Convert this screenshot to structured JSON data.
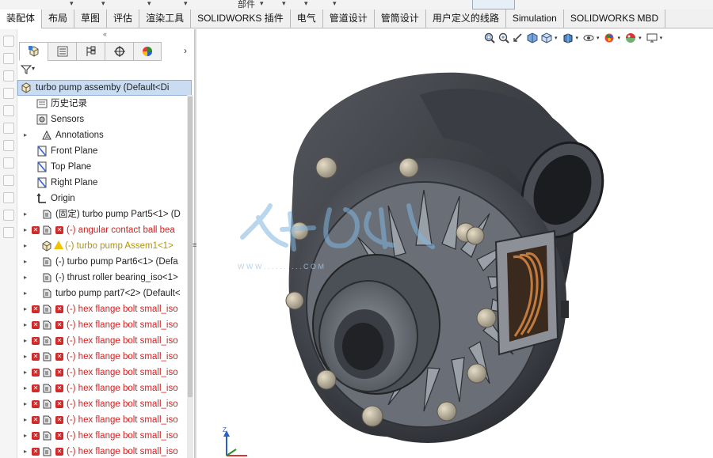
{
  "ribbon": {
    "partial_label": "部件"
  },
  "tabs": [
    {
      "label": "装配体",
      "active": true
    },
    {
      "label": "布局",
      "active": false
    },
    {
      "label": "草图",
      "active": false
    },
    {
      "label": "评估",
      "active": false
    },
    {
      "label": "渲染工具",
      "active": false
    },
    {
      "label": "SOLIDWORKS 插件",
      "active": false
    },
    {
      "label": "电气",
      "active": false
    },
    {
      "label": "管道设计",
      "active": false
    },
    {
      "label": "管筒设计",
      "active": false
    },
    {
      "label": "用户定义的线路",
      "active": false
    },
    {
      "label": "Simulation",
      "active": false
    },
    {
      "label": "SOLIDWORKS MBD",
      "active": false
    }
  ],
  "panel": {
    "collapse_glyph": "«",
    "tabs_more_glyph": "›",
    "tab_icons": [
      "feature-manager-icon",
      "property-manager-icon",
      "configuration-manager-icon",
      "dimxpert-manager-icon",
      "display-manager-icon"
    ],
    "filter_icon": "filter-icon"
  },
  "tree": {
    "root": {
      "label": "turbo pump assemby  (Default<Di",
      "icon": "assembly-icon"
    },
    "items": [
      {
        "label": "历史记录",
        "icon": "history-icon",
        "expander": false,
        "style": "normal",
        "status": ""
      },
      {
        "label": "Sensors",
        "icon": "sensors-icon",
        "expander": false,
        "style": "normal",
        "status": ""
      },
      {
        "label": "Annotations",
        "icon": "annotations-icon",
        "expander": true,
        "style": "normal",
        "status": ""
      },
      {
        "label": "Front Plane",
        "icon": "plane-icon",
        "expander": false,
        "style": "normal",
        "status": ""
      },
      {
        "label": "Top Plane",
        "icon": "plane-icon",
        "expander": false,
        "style": "normal",
        "status": ""
      },
      {
        "label": "Right Plane",
        "icon": "plane-icon",
        "expander": false,
        "style": "normal",
        "status": ""
      },
      {
        "label": "Origin",
        "icon": "origin-icon",
        "expander": false,
        "style": "normal",
        "status": ""
      },
      {
        "label": "(固定) turbo pump Part5<1> (D",
        "icon": "part-icon",
        "expander": true,
        "style": "normal",
        "status": ""
      },
      {
        "label": "(-) angular contact ball bea",
        "icon": "part-icon",
        "expander": true,
        "style": "red",
        "status": "error"
      },
      {
        "label": "(-) turbo pump Assem1<1>",
        "icon": "subassembly-icon",
        "expander": true,
        "style": "gold",
        "status": "warning"
      },
      {
        "label": "(-) turbo pump Part6<1> (Defa",
        "icon": "part-icon",
        "expander": true,
        "style": "normal",
        "status": ""
      },
      {
        "label": "(-) thrust roller bearing_iso<1>",
        "icon": "part-icon",
        "expander": true,
        "style": "normal",
        "status": ""
      },
      {
        "label": "turbo pump part7<2> (Default<",
        "icon": "part-icon",
        "expander": true,
        "style": "normal",
        "status": ""
      },
      {
        "label": "(-) hex flange bolt small_iso",
        "icon": "part-icon",
        "expander": true,
        "style": "red",
        "status": "error"
      },
      {
        "label": "(-) hex flange bolt small_iso",
        "icon": "part-icon",
        "expander": true,
        "style": "red",
        "status": "error"
      },
      {
        "label": "(-) hex flange bolt small_iso",
        "icon": "part-icon",
        "expander": true,
        "style": "red",
        "status": "error"
      },
      {
        "label": "(-) hex flange bolt small_iso",
        "icon": "part-icon",
        "expander": true,
        "style": "red",
        "status": "error"
      },
      {
        "label": "(-) hex flange bolt small_iso",
        "icon": "part-icon",
        "expander": true,
        "style": "red",
        "status": "error"
      },
      {
        "label": "(-) hex flange bolt small_iso",
        "icon": "part-icon",
        "expander": true,
        "style": "red",
        "status": "error"
      },
      {
        "label": "(-) hex flange bolt small_iso",
        "icon": "part-icon",
        "expander": true,
        "style": "red",
        "status": "error"
      },
      {
        "label": "(-) hex flange bolt small_iso",
        "icon": "part-icon",
        "expander": true,
        "style": "red",
        "status": "error"
      },
      {
        "label": "(-) hex flange bolt small_iso",
        "icon": "part-icon",
        "expander": true,
        "style": "red",
        "status": "error"
      },
      {
        "label": "(-) hex flange bolt small_iso",
        "icon": "part-icon",
        "expander": true,
        "style": "red",
        "status": "error"
      }
    ]
  },
  "heads_up": [
    "zoom-to-fit-icon",
    "zoom-area-icon",
    "previous-view-icon",
    "section-view-icon",
    "view-orientation-icon",
    "display-style-icon",
    "hide-show-icon",
    "appearance-icon",
    "scene-icon",
    "view-settings-icon"
  ],
  "triad": {
    "y_label": "Z",
    "x_label": "X"
  },
  "watermark": {
    "caption": "W W W . . . . . . . . . . C O M"
  },
  "colors": {
    "error": "#d42020",
    "warning": "#b59300",
    "selection": "#c9dcf1"
  }
}
